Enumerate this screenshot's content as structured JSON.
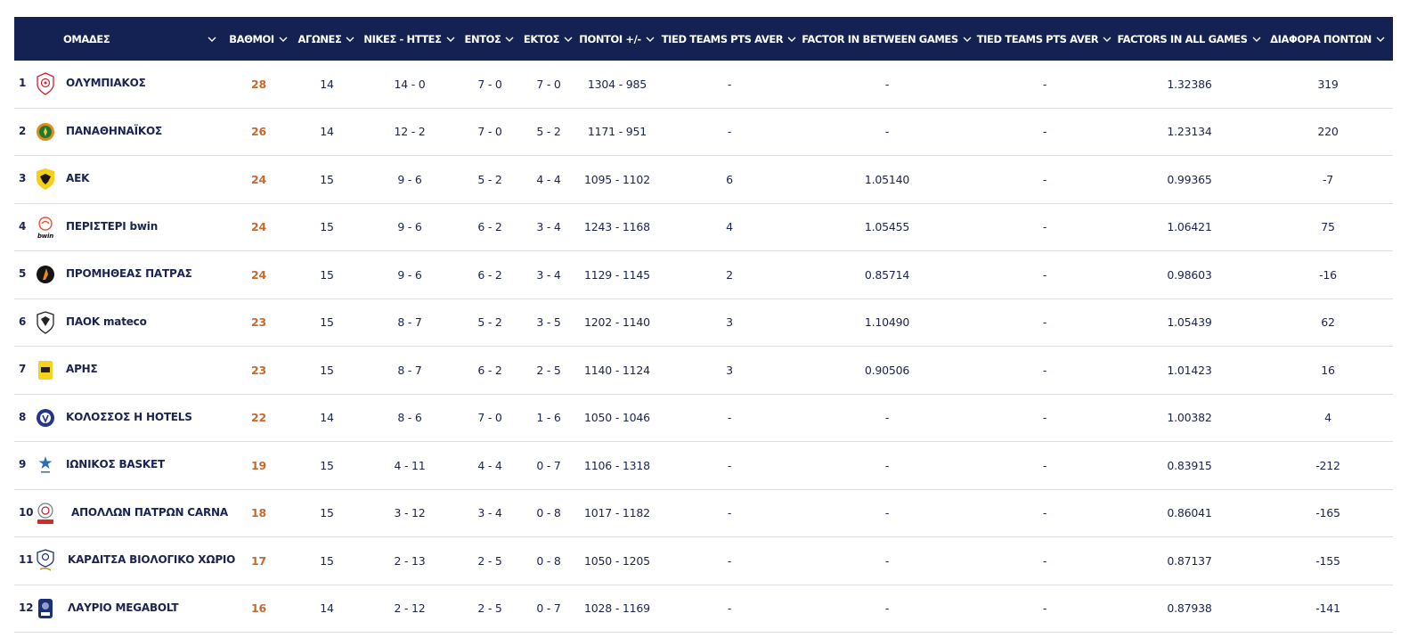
{
  "columns": {
    "team": "ΟΜΑΔΕΣ",
    "points": "ΒΑΘΜΟΙ",
    "games": "ΑΓΩΝΕΣ",
    "wins_losses": "ΝΙΚΕΣ - ΗΤΤΕΣ",
    "home": "ΕΝΤΟΣ",
    "away": "ΕΚΤΟΣ",
    "points_for_against": "ΠΟΝΤΟΙ +/-",
    "tied_pts_1": "TIED TEAMS PTS AVER",
    "factor_between": "FACTOR IN BETWEEN GAMES",
    "tied_pts_2": "TIED TEAMS PTS AVER",
    "factors_all": "FACTORS IN ALL GAMES",
    "diff": "ΔΙΑΦΟΡΑ ΠΟΝΤΩΝ"
  },
  "colors": {
    "header_bg": "#142253",
    "points_accent": "#c9692c",
    "text": "#1b2350"
  },
  "rows": [
    {
      "pos": "1",
      "team": "ΟΛΥΜΠΙΑΚΟΣ",
      "logo": "olympiacos-logo",
      "points": "28",
      "games": "14",
      "wl": "14 - 0",
      "home": "7 - 0",
      "away": "7 - 0",
      "pf": "1304 - 985",
      "tt1": "-",
      "fb": "-",
      "tt2": "-",
      "fa": "1.32386",
      "diff": "319"
    },
    {
      "pos": "2",
      "team": "ΠΑΝΑΘΗΝΑΪΚΟΣ",
      "logo": "panathinaikos-logo",
      "points": "26",
      "games": "14",
      "wl": "12 - 2",
      "home": "7 - 0",
      "away": "5 - 2",
      "pf": "1171 - 951",
      "tt1": "-",
      "fb": "-",
      "tt2": "-",
      "fa": "1.23134",
      "diff": "220"
    },
    {
      "pos": "3",
      "team": "ΑΕΚ",
      "logo": "aek-logo",
      "points": "24",
      "games": "15",
      "wl": "9 - 6",
      "home": "5 - 2",
      "away": "4 - 4",
      "pf": "1095 - 1102",
      "tt1": "6",
      "fb": "1.05140",
      "tt2": "-",
      "fa": "0.99365",
      "diff": "-7"
    },
    {
      "pos": "4",
      "team": "ΠΕΡΙΣΤΕΡΙ bwin",
      "logo": "peristeri-logo",
      "sub": "bwin",
      "points": "24",
      "games": "15",
      "wl": "9 - 6",
      "home": "6 - 2",
      "away": "3 - 4",
      "pf": "1243 - 1168",
      "tt1": "4",
      "fb": "1.05455",
      "tt2": "-",
      "fa": "1.06421",
      "diff": "75"
    },
    {
      "pos": "5",
      "team": "ΠΡΟΜΗΘΕΑΣ ΠΑΤΡΑΣ",
      "logo": "promitheas-logo",
      "points": "24",
      "games": "15",
      "wl": "9 - 6",
      "home": "6 - 2",
      "away": "3 - 4",
      "pf": "1129 - 1145",
      "tt1": "2",
      "fb": "0.85714",
      "tt2": "-",
      "fa": "0.98603",
      "diff": "-16"
    },
    {
      "pos": "6",
      "team": "ΠΑΟΚ mateco",
      "logo": "paok-logo",
      "points": "23",
      "games": "15",
      "wl": "8 - 7",
      "home": "5 - 2",
      "away": "3 - 5",
      "pf": "1202 - 1140",
      "tt1": "3",
      "fb": "1.10490",
      "tt2": "-",
      "fa": "1.05439",
      "diff": "62"
    },
    {
      "pos": "7",
      "team": "ΑΡΗΣ",
      "logo": "aris-logo",
      "points": "23",
      "games": "15",
      "wl": "8 - 7",
      "home": "6 - 2",
      "away": "2 - 5",
      "pf": "1140 - 1124",
      "tt1": "3",
      "fb": "0.90506",
      "tt2": "-",
      "fa": "1.01423",
      "diff": "16"
    },
    {
      "pos": "8",
      "team": "ΚΟΛΟΣΣΟΣ Η HOTELS",
      "logo": "kolossos-logo",
      "points": "22",
      "games": "14",
      "wl": "8 - 6",
      "home": "7 - 0",
      "away": "1 - 6",
      "pf": "1050 - 1046",
      "tt1": "-",
      "fb": "-",
      "tt2": "-",
      "fa": "1.00382",
      "diff": "4"
    },
    {
      "pos": "9",
      "team": "ΙΩΝΙΚΟΣ BASKET",
      "logo": "ionikos-logo",
      "points": "19",
      "games": "15",
      "wl": "4 - 11",
      "home": "4 - 4",
      "away": "0 - 7",
      "pf": "1106 - 1318",
      "tt1": "-",
      "fb": "-",
      "tt2": "-",
      "fa": "0.83915",
      "diff": "-212"
    },
    {
      "pos": "10",
      "team": "ΑΠΟΛΛΩΝ ΠΑΤΡΩΝ CARNA",
      "logo": "apollon-logo",
      "points": "18",
      "games": "15",
      "wl": "3 - 12",
      "home": "3 - 4",
      "away": "0 - 8",
      "pf": "1017 - 1182",
      "tt1": "-",
      "fb": "-",
      "tt2": "-",
      "fa": "0.86041",
      "diff": "-165"
    },
    {
      "pos": "11",
      "team": "ΚΑΡΔΙΤΣΑ ΒΙΟΛΟΓΙΚΟ ΧΩΡΙΟ",
      "logo": "karditsa-logo",
      "points": "17",
      "games": "15",
      "wl": "2 - 13",
      "home": "2 - 5",
      "away": "0 - 8",
      "pf": "1050 - 1205",
      "tt1": "-",
      "fb": "-",
      "tt2": "-",
      "fa": "0.87137",
      "diff": "-155"
    },
    {
      "pos": "12",
      "team": "ΛΑΥΡΙΟ MEGABOLT",
      "logo": "lavrio-logo",
      "points": "16",
      "games": "14",
      "wl": "2 - 12",
      "home": "2 - 5",
      "away": "0 - 7",
      "pf": "1028 - 1169",
      "tt1": "-",
      "fb": "-",
      "tt2": "-",
      "fa": "0.87938",
      "diff": "-141"
    }
  ]
}
